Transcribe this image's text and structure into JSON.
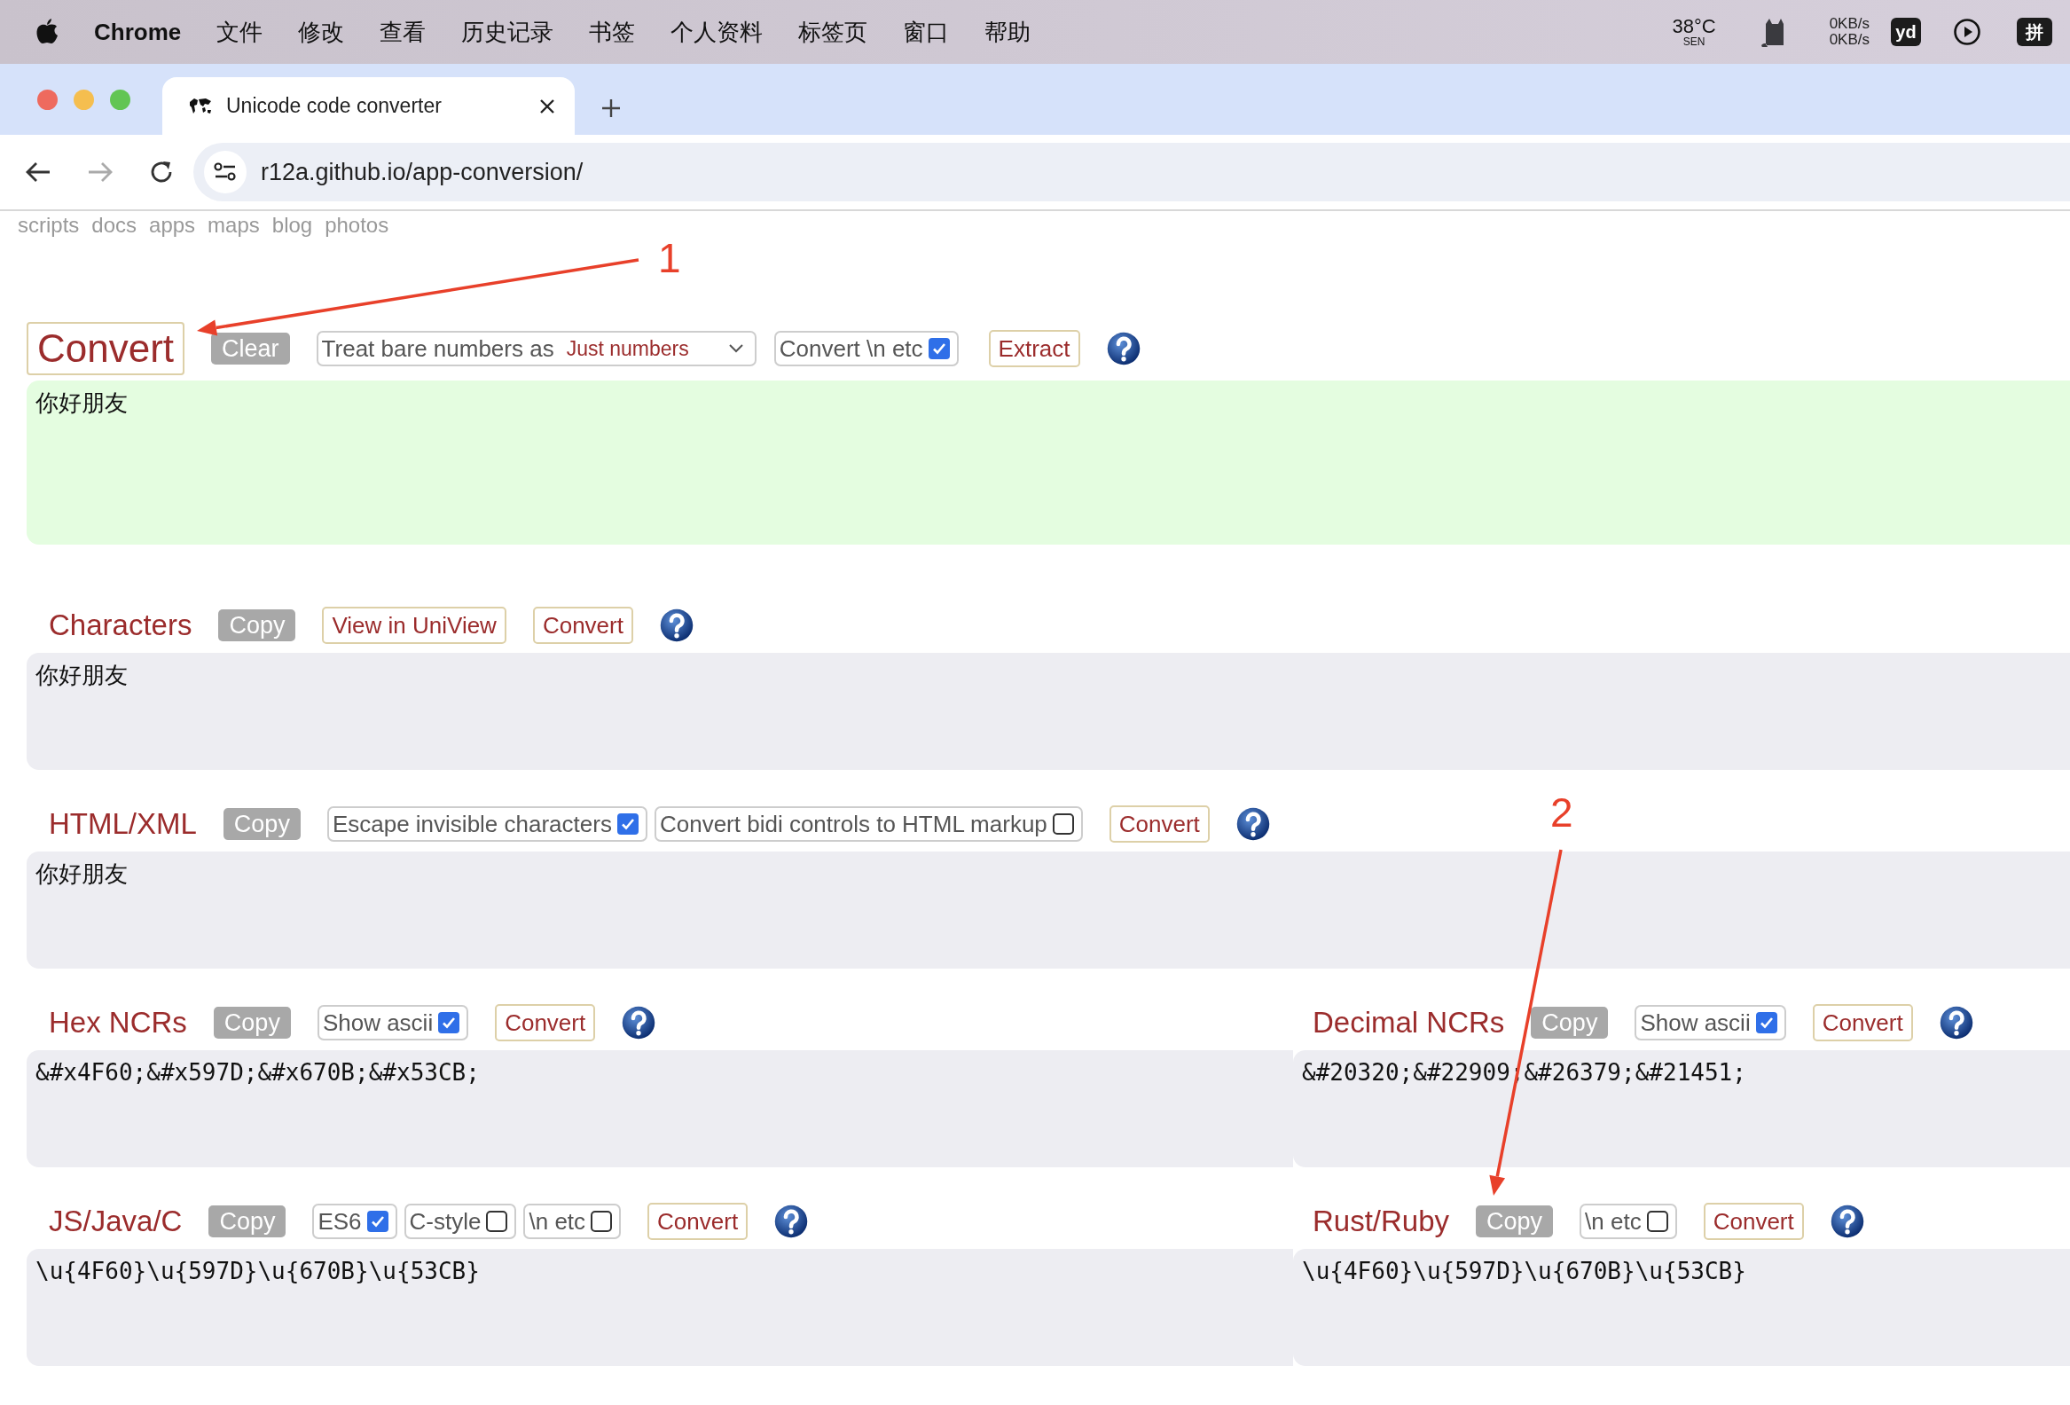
{
  "menubar": {
    "app": "Chrome",
    "menus": [
      "文件",
      "修改",
      "查看",
      "历史记录",
      "书签",
      "个人资料",
      "标签页",
      "窗口",
      "帮助"
    ],
    "temperature": "38°C",
    "temperature_label": "SEN",
    "net_up": "0KB/s",
    "net_down": "0KB/s",
    "dict_badge": "yd",
    "input_method": "拼"
  },
  "browser": {
    "tab_title": "Unicode code converter",
    "url": "r12a.github.io/app-conversion/"
  },
  "site_nav": [
    "scripts",
    "docs",
    "apps",
    "maps",
    "blog",
    "photos"
  ],
  "input_section": {
    "convert": "Convert",
    "clear": "Clear",
    "bare_numbers_label": "Treat bare numbers as",
    "bare_numbers_value": "Just numbers",
    "escapes": {
      "label": "Convert \\n etc",
      "checked": true
    },
    "extract": "Extract",
    "text": "你好朋友"
  },
  "rows": [
    [
      {
        "title": "Characters",
        "copy": "Copy",
        "controls": [
          {
            "kind": "button",
            "label": "View in UniView"
          },
          {
            "kind": "button",
            "label": "Convert"
          }
        ],
        "text": "你好朋友"
      }
    ],
    [
      {
        "title": "HTML/XML",
        "copy": "Copy",
        "controls": [
          {
            "kind": "checkbox",
            "label": "Escape invisible characters",
            "checked": true
          },
          {
            "kind": "checkbox",
            "label": "Convert bidi controls to HTML markup",
            "checked": false
          },
          {
            "kind": "button",
            "label": "Convert"
          }
        ],
        "text": "你好朋友"
      }
    ],
    [
      {
        "title": "Hex NCRs",
        "copy": "Copy",
        "controls": [
          {
            "kind": "checkbox",
            "label": "Show ascii",
            "checked": true
          },
          {
            "kind": "button",
            "label": "Convert"
          }
        ],
        "text": "&#x4F60;&#x597D;&#x670B;&#x53CB;"
      },
      {
        "title": "Decimal NCRs",
        "copy": "Copy",
        "controls": [
          {
            "kind": "checkbox",
            "label": "Show ascii",
            "checked": true
          },
          {
            "kind": "button",
            "label": "Convert"
          }
        ],
        "text": "&#20320;&#22909;&#26379;&#21451;"
      }
    ],
    [
      {
        "title": "JS/Java/C",
        "copy": "Copy",
        "controls": [
          {
            "kind": "checkbox",
            "label": "ES6",
            "checked": true
          },
          {
            "kind": "checkbox",
            "label": "C-style",
            "checked": false
          },
          {
            "kind": "checkbox",
            "label": "\\n etc",
            "checked": false
          },
          {
            "kind": "button",
            "label": "Convert"
          }
        ],
        "text": "\\u{4F60}\\u{597D}\\u{670B}\\u{53CB}"
      },
      {
        "title": "Rust/Ruby",
        "copy": "Copy",
        "controls": [
          {
            "kind": "checkbox",
            "label": "\\n etc",
            "checked": false
          },
          {
            "kind": "button",
            "label": "Convert"
          }
        ],
        "text": "\\u{4F60}\\u{597D}\\u{670B}\\u{53CB}"
      }
    ]
  ],
  "annotations": [
    {
      "label": "1"
    },
    {
      "label": "2"
    }
  ]
}
